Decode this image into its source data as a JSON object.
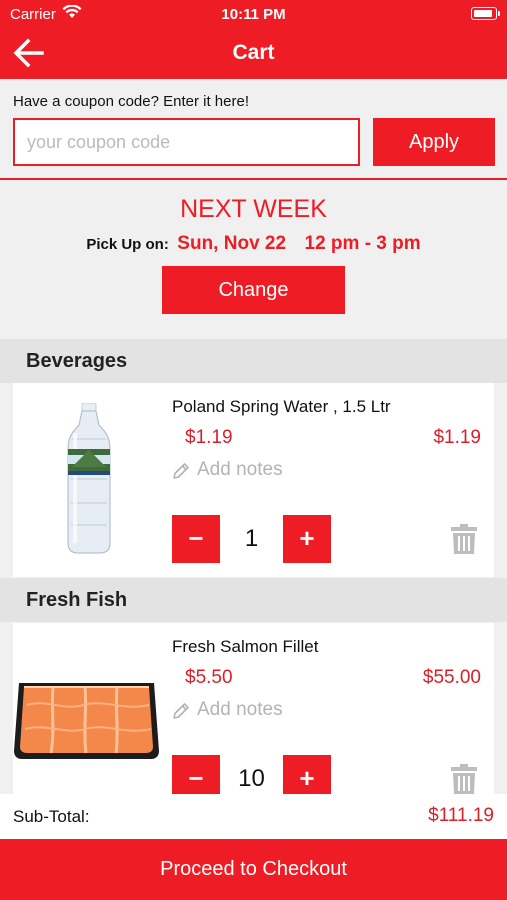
{
  "status_bar": {
    "carrier": "Carrier",
    "time": "10:11 PM"
  },
  "header": {
    "title": "Cart",
    "back_icon": "arrow-left-icon"
  },
  "coupon": {
    "label": "Have a coupon code? Enter it here!",
    "placeholder": "your coupon code",
    "value": "",
    "apply_label": "Apply"
  },
  "pickup": {
    "week": "NEXT WEEK",
    "label": "Pick Up on:",
    "date": "Sun, Nov 22",
    "time": "12 pm - 3 pm",
    "change_label": "Change"
  },
  "categories": [
    {
      "name": "Beverages",
      "items": [
        {
          "name": "Poland Spring Water , 1.5 Ltr",
          "price": "$1.19",
          "total": "$1.19",
          "notes": "Add notes",
          "quantity": "1",
          "image": "water-bottle-image"
        }
      ]
    },
    {
      "name": "Fresh Fish",
      "items": [
        {
          "name": "Fresh Salmon Fillet",
          "price": "$5.50",
          "total": "$55.00",
          "notes": "Add notes",
          "quantity": "10",
          "image": "salmon-fillet-image"
        }
      ]
    }
  ],
  "qty_controls": {
    "minus": "−",
    "plus": "+"
  },
  "summary": {
    "subtotal_label": "Sub-Total:",
    "subtotal_value": "$111.19"
  },
  "checkout_label": "Proceed to Checkout",
  "colors": {
    "accent": "#ee1c25",
    "price": "#d9202a",
    "background": "#f0f0f0"
  }
}
